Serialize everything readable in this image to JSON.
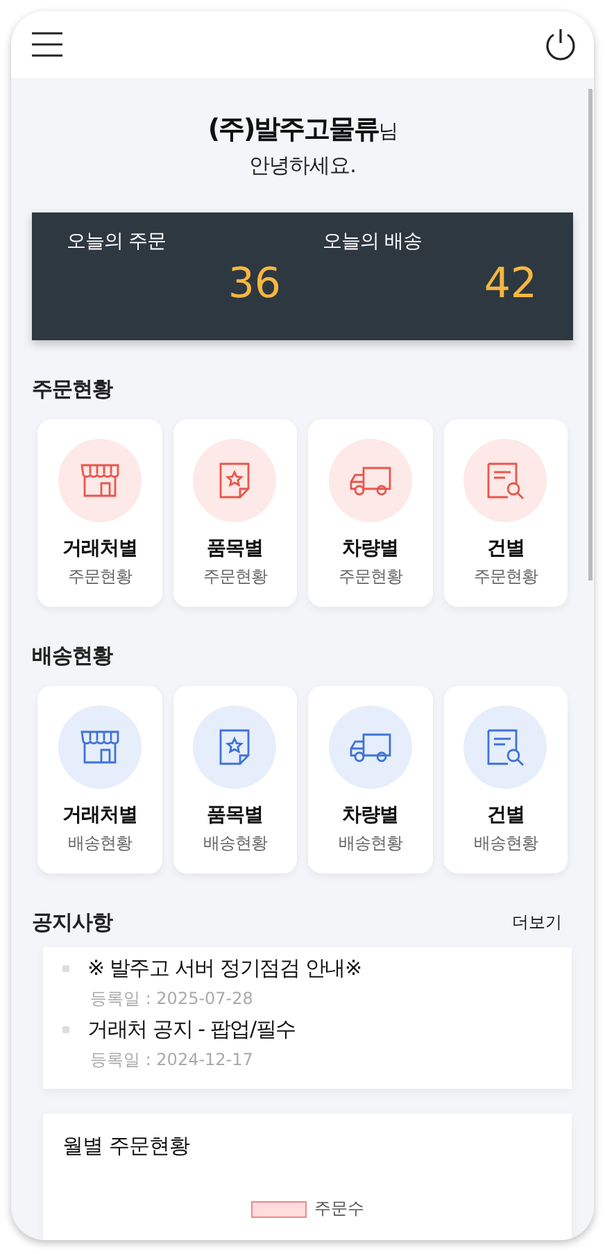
{
  "greeting": {
    "company": "(주)발주고물류",
    "suffix": "님",
    "hello": "안녕하세요."
  },
  "today": [
    {
      "label": "오늘의 주문",
      "value": "36"
    },
    {
      "label": "오늘의 배송",
      "value": "42"
    }
  ],
  "sections": [
    {
      "title": "주문현황",
      "kind": "order",
      "tiles": [
        {
          "kind": "store",
          "title": "거래처별",
          "sub": "주문현황"
        },
        {
          "kind": "item",
          "title": "품목별",
          "sub": "주문현황"
        },
        {
          "kind": "truck",
          "title": "차량별",
          "sub": "주문현황"
        },
        {
          "kind": "doc",
          "title": "건별",
          "sub": "주문현황"
        }
      ]
    },
    {
      "title": "배송현황",
      "kind": "delivery",
      "tiles": [
        {
          "kind": "store",
          "title": "거래처별",
          "sub": "배송현황"
        },
        {
          "kind": "item",
          "title": "품목별",
          "sub": "배송현황"
        },
        {
          "kind": "truck",
          "title": "차량별",
          "sub": "배송현황"
        },
        {
          "kind": "doc",
          "title": "건별",
          "sub": "배송현황"
        }
      ]
    }
  ],
  "notices": {
    "title": "공지사항",
    "more": "더보기",
    "items": [
      {
        "title": "※ 발주고 서버 정기점검 안내※",
        "date": "등록일 : 2025-07-28"
      },
      {
        "title": "거래처 공지 - 팝업/필수",
        "date": "등록일 : 2024-12-17"
      }
    ]
  },
  "monthly": {
    "title": "월별 주문현황",
    "legend": "주문수"
  }
}
